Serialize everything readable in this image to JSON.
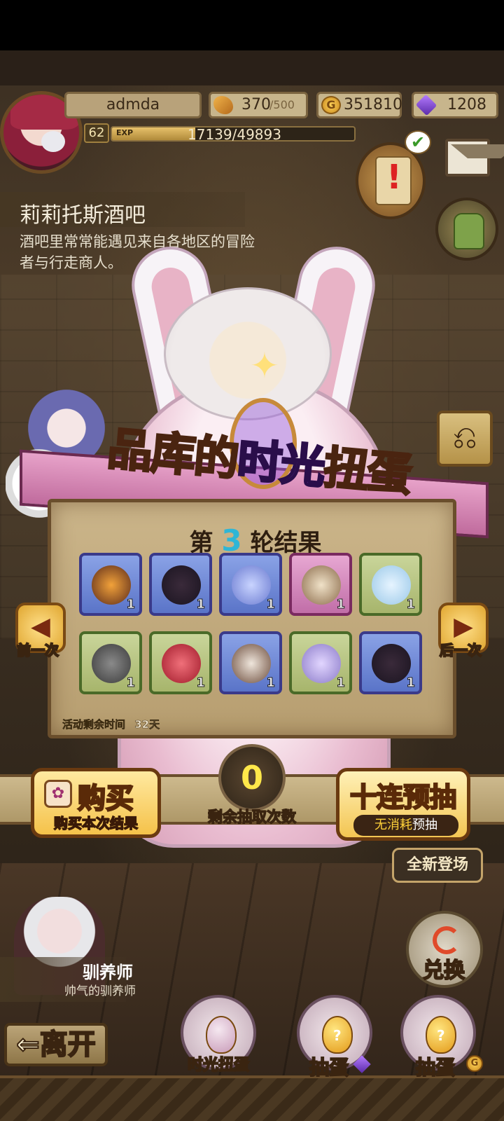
{
  "player": {
    "name": "admda",
    "level": "62",
    "exp_label": "EXP",
    "exp_value": "17139/49893",
    "exp_fraction": 0.3435
  },
  "resources": {
    "stamina_current": "370",
    "stamina_max": "/500",
    "gold": "351810",
    "gold_symbol": "G",
    "gems": "1208"
  },
  "location": {
    "name": "莉莉托斯酒吧",
    "description": "酒吧里常常能遇见来自各地区的冒险者与行走商人。"
  },
  "gacha": {
    "title_part1": "品库的",
    "title_part2": "时光",
    "title_part3": "扭蛋",
    "round_prefix": "第",
    "round_number": "3",
    "round_suffix": "轮结果",
    "remaining_time_label": "活动剩余时间",
    "remaining_time_value": "32天",
    "items": [
      {
        "icon": "flame-beast-icon",
        "qty": "1",
        "rarity": "blue"
      },
      {
        "icon": "dark-wing-icon",
        "qty": "1",
        "rarity": "blue"
      },
      {
        "icon": "crystal-stone-icon",
        "qty": "1",
        "rarity": "blue"
      },
      {
        "icon": "striped-egg-icon",
        "qty": "1",
        "rarity": "pink"
      },
      {
        "icon": "potion-flask-icon",
        "qty": "1",
        "rarity": "green"
      },
      {
        "icon": "iron-helmet-icon",
        "qty": "1",
        "rarity": "green"
      },
      {
        "icon": "red-egg-icon",
        "qty": "1",
        "rarity": "green"
      },
      {
        "icon": "book-icon",
        "qty": "1",
        "rarity": "blue"
      },
      {
        "icon": "lavender-crystal-icon",
        "qty": "1",
        "rarity": "green"
      },
      {
        "icon": "dark-wing-icon",
        "qty": "1",
        "rarity": "blue"
      }
    ],
    "prev_label": "前一次",
    "next_label": "后一次",
    "draw_count": "0",
    "draw_count_label": "剩余抽取次数"
  },
  "actions": {
    "buy_label": "购买",
    "buy_sub": "购买本次结果",
    "ten_label": "十连预抽",
    "ten_sub_hl": "无消耗",
    "ten_sub_rest": "预抽",
    "new_banner": "全新登场",
    "exchange_label": "兑换",
    "leave_label": "⇐离开"
  },
  "trainer": {
    "name": "驯养师",
    "desc": "帅气的驯养师"
  },
  "bottom_menu": {
    "time_gacha": "时光扭蛋",
    "draw_gem": "抽蛋",
    "draw_gold": "抽蛋",
    "gold_symbol": "G"
  },
  "colors": {
    "accent_gold": "#f5c24a",
    "round_number": "#2fb6d6",
    "draw_count": "#ffe84a",
    "gem_purple": "#9a52e8"
  }
}
